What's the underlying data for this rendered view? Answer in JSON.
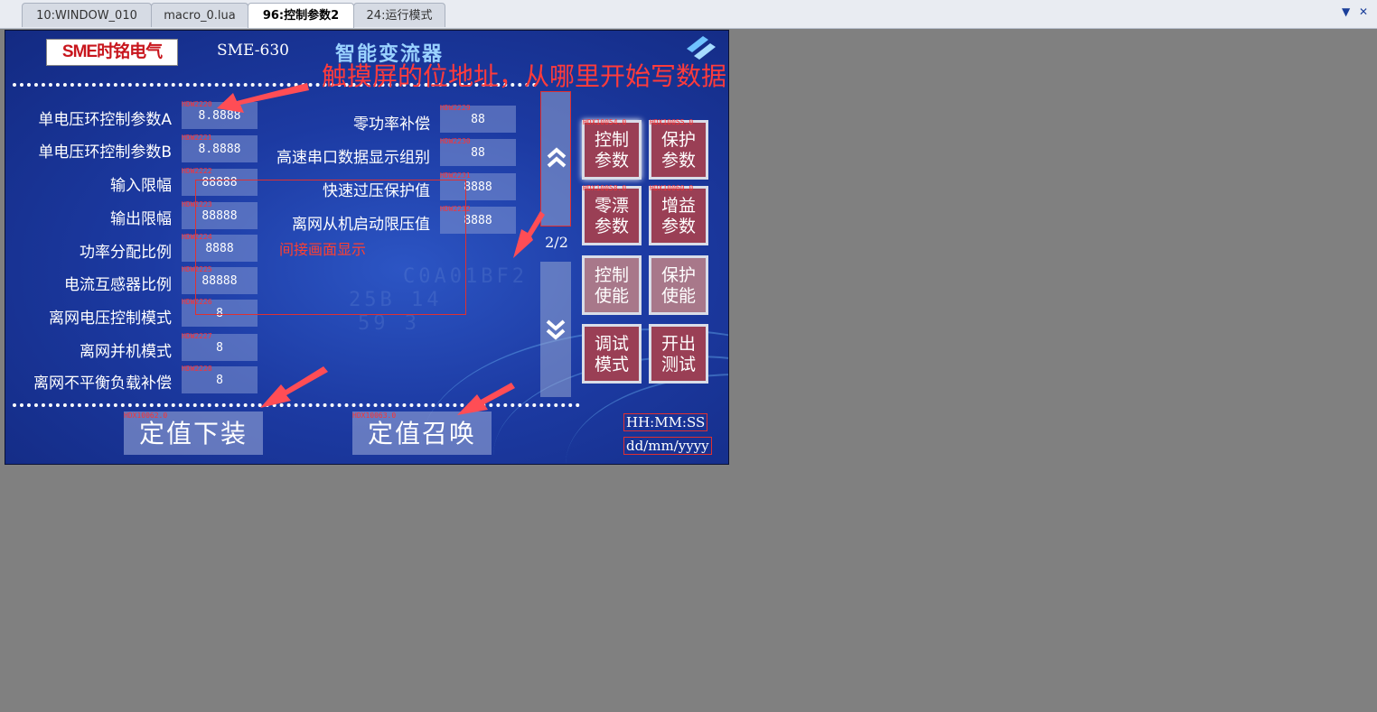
{
  "tabs": [
    {
      "label": "10:WINDOW_010"
    },
    {
      "label": "macro_0.lua"
    },
    {
      "label": "96:控制参数2"
    },
    {
      "label": "24:运行模式"
    }
  ],
  "tab_controls": {
    "dropdown_icon": "triangle-down-icon",
    "close_icon": "close-icon",
    "dropdown": "▼",
    "close": "✕"
  },
  "header": {
    "logo": "SME时铭电气",
    "model": "SME-630",
    "brand": "智能变流器"
  },
  "annotations": {
    "note": "触摸屏的位地址，从哪里开始写数据",
    "indirect": "间接画面显示",
    "arrow_color": "#ff4d55"
  },
  "left_params": [
    {
      "label": "单电压环控制参数A",
      "tag": "HDW2220",
      "value": "8.8888"
    },
    {
      "label": "单电压环控制参数B",
      "tag": "HDW2221",
      "value": "8.8888"
    },
    {
      "label": "输入限幅",
      "tag": "HDW2222",
      "value": "88888"
    },
    {
      "label": "输出限幅",
      "tag": "HDW2223",
      "value": "88888"
    },
    {
      "label": "功率分配比例",
      "tag": "HDW2224",
      "value": "8888"
    },
    {
      "label": "电流互感器比例",
      "tag": "HDW2225",
      "value": "88888"
    },
    {
      "label": "离网电压控制模式",
      "tag": "HDW2226",
      "value": "8"
    },
    {
      "label": "离网并机模式",
      "tag": "HDW2227",
      "value": "8"
    },
    {
      "label": "离网不平衡负载补偿",
      "tag": "HDW2228",
      "value": "8"
    }
  ],
  "right_params": [
    {
      "label": "零功率补偿",
      "tag": "HDW2229",
      "value": "88"
    },
    {
      "label": "高速串口数据显示组别",
      "tag": "HDW2230",
      "value": "88"
    },
    {
      "label": "快速过压保护值",
      "tag": "HDW2231",
      "value": "8888"
    },
    {
      "label": "离网从机启动限压值",
      "tag": "HDW2232",
      "value": "8888"
    }
  ],
  "pager": {
    "page": "2/2",
    "up_icon": "double-chevron-up-icon",
    "down_icon": "double-chevron-down-icon"
  },
  "menu": [
    {
      "label": "控制参数",
      "tag": "HDX10054.0",
      "selected": true
    },
    {
      "label": "保护参数",
      "tag": "HDX10055.0"
    },
    {
      "label": "零漂参数",
      "tag": "HDX10058.0"
    },
    {
      "label": "增益参数",
      "tag": "HDX10060.0"
    },
    {
      "label": "控制使能",
      "tag": ""
    },
    {
      "label": "保护使能",
      "tag": ""
    },
    {
      "label": "调试模式",
      "tag": ""
    },
    {
      "label": "开出测试",
      "tag": ""
    }
  ],
  "actions": [
    {
      "label": "定值下装",
      "tag": "HDX10062.0"
    },
    {
      "label": "定值召唤",
      "tag": "HDX10063.0"
    }
  ],
  "clock": {
    "time": "HH:MM:SS",
    "date": "dd/mm/yyyy"
  },
  "background_hex": [
    "C0A01BF2",
    "25B 14",
    "59  3"
  ]
}
